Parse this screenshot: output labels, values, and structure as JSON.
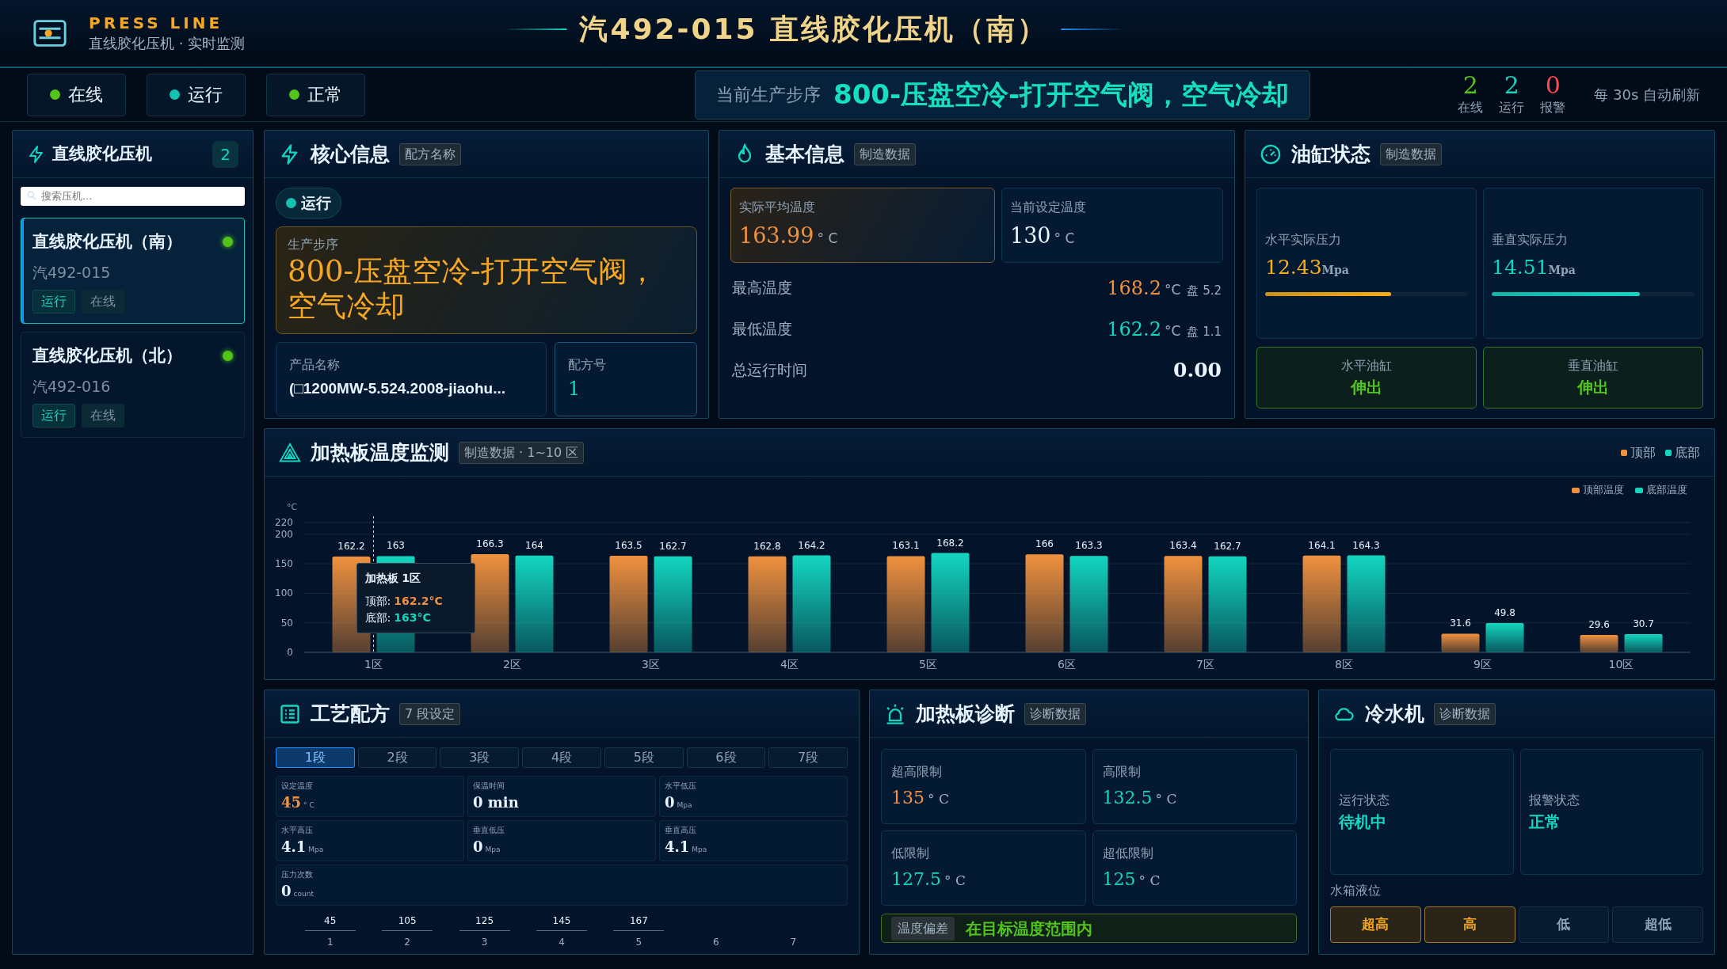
{
  "header": {
    "brand": "PRESS LINE",
    "subtitle": "直线胶化压机 · 实时监测",
    "title": "汽492-015 直线胶化压机（南）"
  },
  "status_pills": [
    {
      "label": "在线",
      "color": "#52c41a"
    },
    {
      "label": "运行",
      "color": "#13c2b0"
    },
    {
      "label": "正常",
      "color": "#52c41a"
    }
  ],
  "current_step": {
    "label": "当前生产步序",
    "value": "800-压盘空冷-打开空气阀，空气冷却"
  },
  "counters": [
    {
      "value": "2",
      "label": "在线",
      "color": "#52c41a"
    },
    {
      "value": "2",
      "label": "运行",
      "color": "#13d6c0"
    },
    {
      "value": "0",
      "label": "报警",
      "color": "#ff4d4f"
    }
  ],
  "refresh_note": "每 30s 自动刷新",
  "sidebar": {
    "title": "直线胶化压机",
    "count": "2",
    "search_placeholder": "搜索压机...",
    "items": [
      {
        "name": "直线胶化压机（南）",
        "code": "汽492-015",
        "tags": [
          "运行",
          "在线"
        ],
        "selected": true,
        "online": true
      },
      {
        "name": "直线胶化压机（北）",
        "code": "汽492-016",
        "tags": [
          "运行",
          "在线"
        ],
        "selected": false,
        "online": true
      }
    ]
  },
  "core_info": {
    "title": "核心信息",
    "tag": "配方名称",
    "run_state": "运行",
    "step_label": "生产步序",
    "step_value": "800-压盘空冷-打开空气阀，空气冷却",
    "product_label": "产品名称",
    "product_value": "(□1200MW-5.524.2008-jiaohu...",
    "recipe_label": "配方号",
    "recipe_value": "1"
  },
  "basic_info": {
    "title": "基本信息",
    "tag": "制造数据",
    "cards": [
      {
        "label": "实际平均温度",
        "value": "163.99",
        "unit": "° C",
        "highlight": true
      },
      {
        "label": "当前设定温度",
        "value": "130",
        "unit": "° C",
        "highlight": false
      }
    ],
    "rows": [
      {
        "label": "最高温度",
        "value": "168.2",
        "unit": "°C",
        "note": "盘 5.2",
        "kind": "warm"
      },
      {
        "label": "最低温度",
        "value": "162.2",
        "unit": "°C",
        "note": "盘 1.1",
        "kind": "cool"
      },
      {
        "label": "总运行时间",
        "value": "0.00",
        "kind": "plain"
      }
    ]
  },
  "cylinder_status": {
    "title": "油缸状态",
    "tag": "制造数据",
    "pressures": [
      {
        "label": "水平实际压力",
        "value": "12.43",
        "unit": "Mpa",
        "level": 0.62,
        "color": "#faad14"
      },
      {
        "label": "垂直实际压力",
        "value": "14.51",
        "unit": "Mpa",
        "level": 0.73,
        "color": "#13d6c0"
      }
    ],
    "cylinders": [
      {
        "label": "水平油缸",
        "state": "伸出"
      },
      {
        "label": "垂直油缸",
        "state": "伸出"
      }
    ]
  },
  "temperature_monitor": {
    "title": "加热板温度监测",
    "tag": "制造数据 · 1~10 区",
    "legend": [
      "顶部",
      "底部"
    ],
    "chart_data": {
      "type": "bar",
      "ylabel": "°C",
      "categories": [
        "1区",
        "2区",
        "3区",
        "4区",
        "5区",
        "6区",
        "7区",
        "8区",
        "9区",
        "10区"
      ],
      "ylim": [
        0,
        220
      ],
      "yticks": [
        0,
        50,
        100,
        150,
        200,
        220
      ],
      "data_labels": true,
      "grid": true,
      "legend": true,
      "ref_lines": [
        {
          "axis": "x",
          "value": "1区"
        }
      ],
      "series": [
        {
          "name": "顶部温度",
          "color": "#f0913f",
          "values": [
            162.2,
            166.3,
            163.5,
            162.8,
            163.1,
            166,
            163.4,
            164.1,
            31.6,
            29.6
          ]
        },
        {
          "name": "底部温度",
          "color": "#13d6c0",
          "values": [
            163,
            164,
            162.7,
            164.2,
            168.2,
            163.3,
            162.7,
            164.3,
            49.8,
            30.7
          ]
        }
      ]
    },
    "tooltip": {
      "title": "加热板 1区",
      "rows": [
        {
          "label": "顶部:",
          "value": "162.2°C"
        },
        {
          "label": "底部:",
          "value": "163°C"
        }
      ]
    }
  },
  "recipe": {
    "title": "工艺配方",
    "tag": "7 段设定",
    "tabs": [
      {
        "label": "1段",
        "selected": true
      },
      {
        "label": "2段",
        "selected": false
      },
      {
        "label": "3段",
        "selected": false
      },
      {
        "label": "4段",
        "selected": false
      },
      {
        "label": "5段",
        "selected": false
      },
      {
        "label": "6段",
        "selected": false
      },
      {
        "label": "7段",
        "selected": false
      }
    ],
    "params": [
      {
        "label": "设定温度",
        "value": "45",
        "unit": "° C",
        "kind": "warm"
      },
      {
        "label": "保温时间",
        "value": "0 min",
        "kind": "plain"
      },
      {
        "label": "水平低压",
        "value": "0",
        "unit": "Mpa",
        "kind": "plain"
      },
      {
        "label": "水平高压",
        "value": "4.1",
        "unit": "Mpa",
        "kind": "plain"
      },
      {
        "label": "垂直低压",
        "value": "0",
        "unit": "Mpa",
        "kind": "plain"
      },
      {
        "label": "垂直高压",
        "value": "4.1",
        "unit": "Mpa",
        "kind": "plain"
      },
      {
        "label": "压力次数",
        "value": "0",
        "unit": "count",
        "kind": "wide"
      }
    ],
    "steps": [
      {
        "label": "1",
        "value": "45"
      },
      {
        "label": "2",
        "value": "105"
      },
      {
        "label": "3",
        "value": "125"
      },
      {
        "label": "4",
        "value": "145"
      },
      {
        "label": "5",
        "value": "167"
      },
      {
        "label": "6"
      },
      {
        "label": "7"
      }
    ]
  },
  "diagnosis": {
    "title": "加热板诊断",
    "tag": "诊断数据",
    "limits": [
      {
        "label": "超高限制",
        "value": "135",
        "unit": "° C",
        "kind": "warm"
      },
      {
        "label": "高限制",
        "value": "132.5",
        "unit": "° C",
        "kind": "cool"
      },
      {
        "label": "低限制",
        "value": "127.5",
        "unit": "° C",
        "kind": "cool"
      },
      {
        "label": "超低限制",
        "value": "125",
        "unit": "° C",
        "kind": "cool"
      }
    ],
    "deviation": {
      "label": "温度偏差",
      "value": "在目标温度范围内"
    }
  },
  "chiller": {
    "title": "冷水机",
    "tag": "诊断数据",
    "states": [
      {
        "label": "运行状态",
        "value": "待机中"
      },
      {
        "label": "报警状态",
        "value": "正常"
      }
    ],
    "tank": {
      "label": "水箱液位",
      "levels": [
        {
          "label": "超高",
          "on": true
        },
        {
          "label": "高",
          "on": true
        },
        {
          "label": "低",
          "on": false
        },
        {
          "label": "超低",
          "on": false
        }
      ]
    }
  }
}
